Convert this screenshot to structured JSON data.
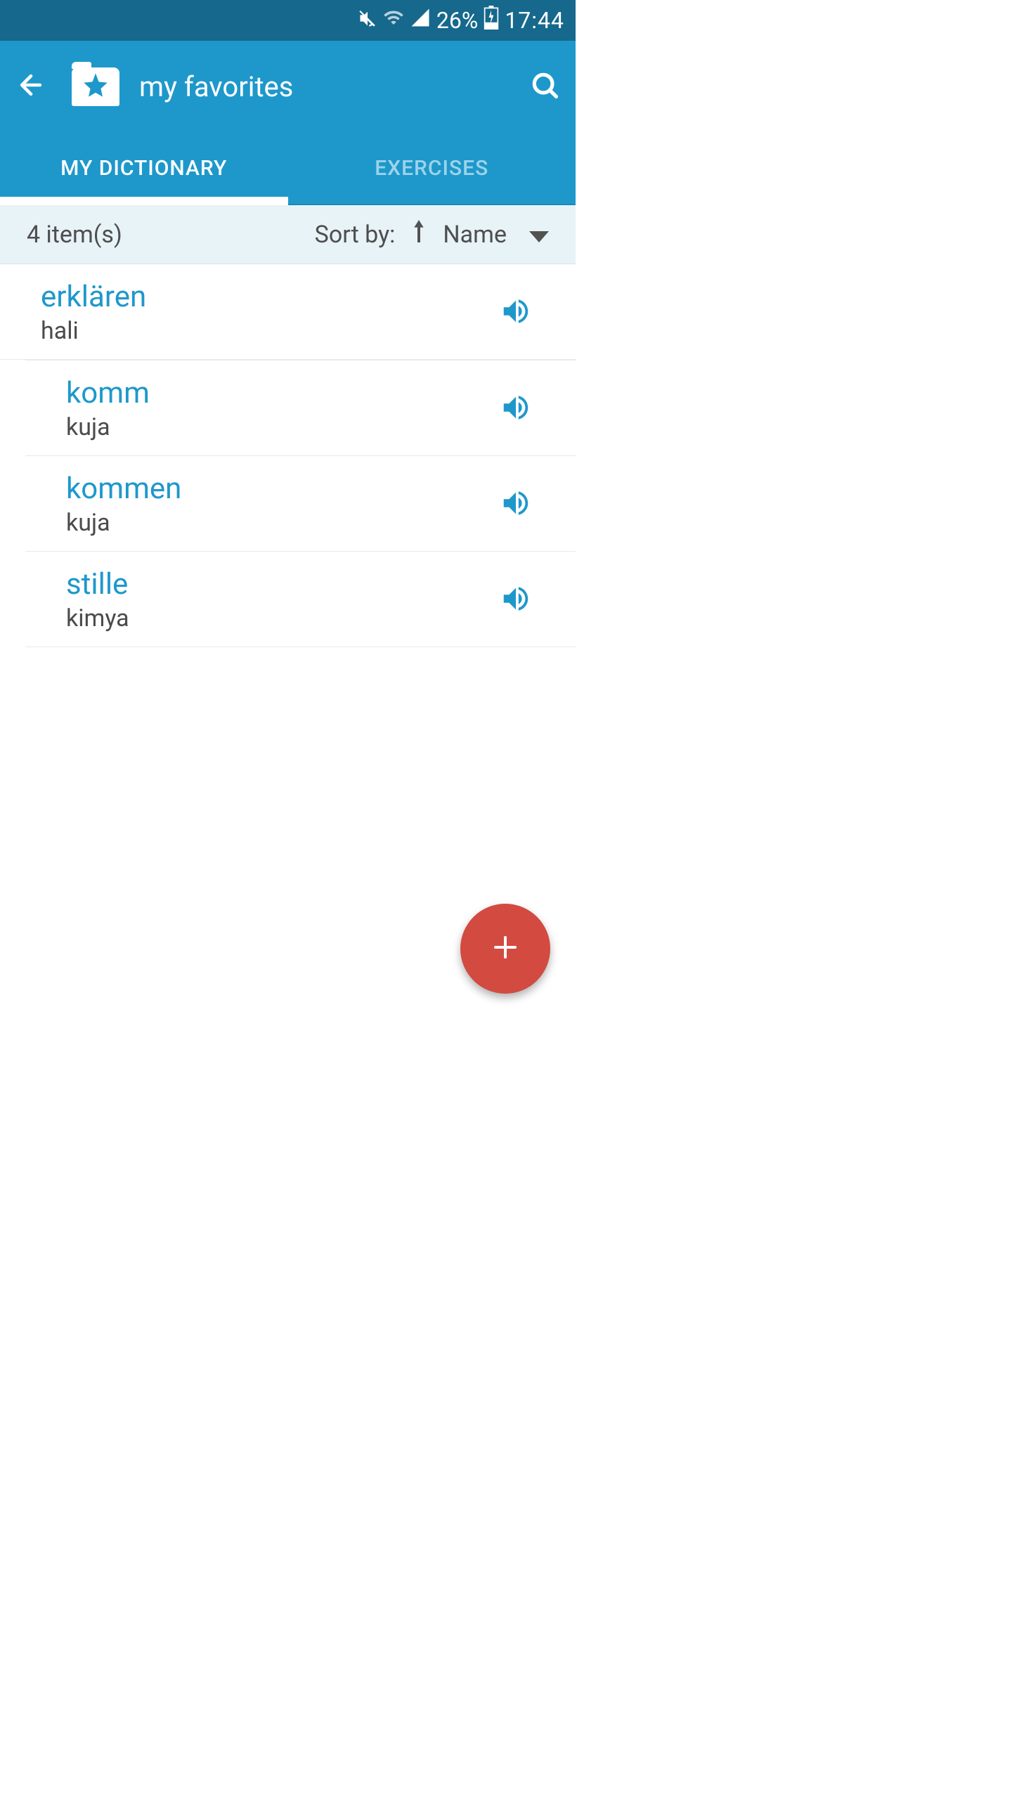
{
  "status": {
    "battery_pct": "26%",
    "time": "17:44"
  },
  "header": {
    "title": "my favorites"
  },
  "tabs": {
    "dictionary": "MY DICTIONARY",
    "exercises": "EXERCISES"
  },
  "sort": {
    "count": "4 item(s)",
    "label": "Sort by:",
    "field": "Name"
  },
  "items": [
    {
      "word": "erklären",
      "translation": "hali"
    },
    {
      "word": "komm",
      "translation": "kuja"
    },
    {
      "word": "kommen",
      "translation": "kuja"
    },
    {
      "word": "stille",
      "translation": "kimya"
    }
  ]
}
